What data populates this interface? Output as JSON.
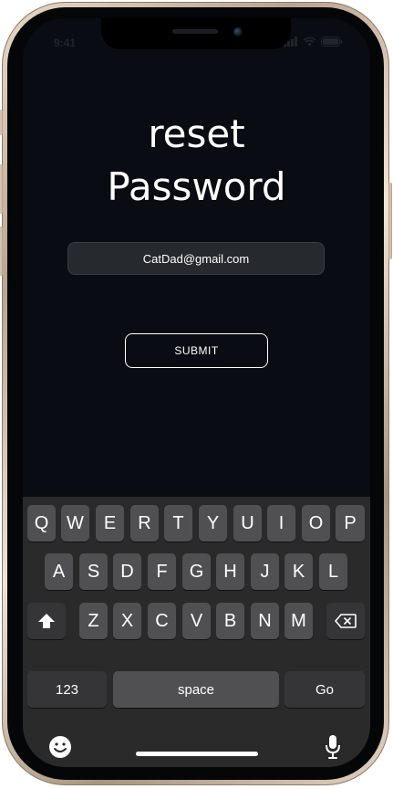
{
  "status_bar": {
    "time": "9:41",
    "icons": [
      "signal-icon",
      "wifi-icon",
      "battery-icon"
    ]
  },
  "screen": {
    "title_line1": "reset",
    "title_line2": "Password",
    "email_value": "CatDad@gmail.com",
    "submit_label": "SUBMIT"
  },
  "keyboard": {
    "row1": [
      "Q",
      "W",
      "E",
      "R",
      "T",
      "Y",
      "U",
      "I",
      "O",
      "P"
    ],
    "row2": [
      "A",
      "S",
      "D",
      "F",
      "G",
      "H",
      "J",
      "K",
      "L"
    ],
    "row3": [
      "Z",
      "X",
      "C",
      "V",
      "B",
      "N",
      "M"
    ],
    "numbers_label": "123",
    "space_label": "space",
    "go_label": "Go",
    "icons": [
      "shift-icon",
      "delete-icon",
      "emoji-icon",
      "microphone-icon"
    ]
  },
  "colors": {
    "screen_background": "#090c12",
    "keyboard_background": "#2a2a2b",
    "key_background": "#505052",
    "special_key_background": "#353537",
    "field_background": "#26292e",
    "text": "#ffffff"
  }
}
